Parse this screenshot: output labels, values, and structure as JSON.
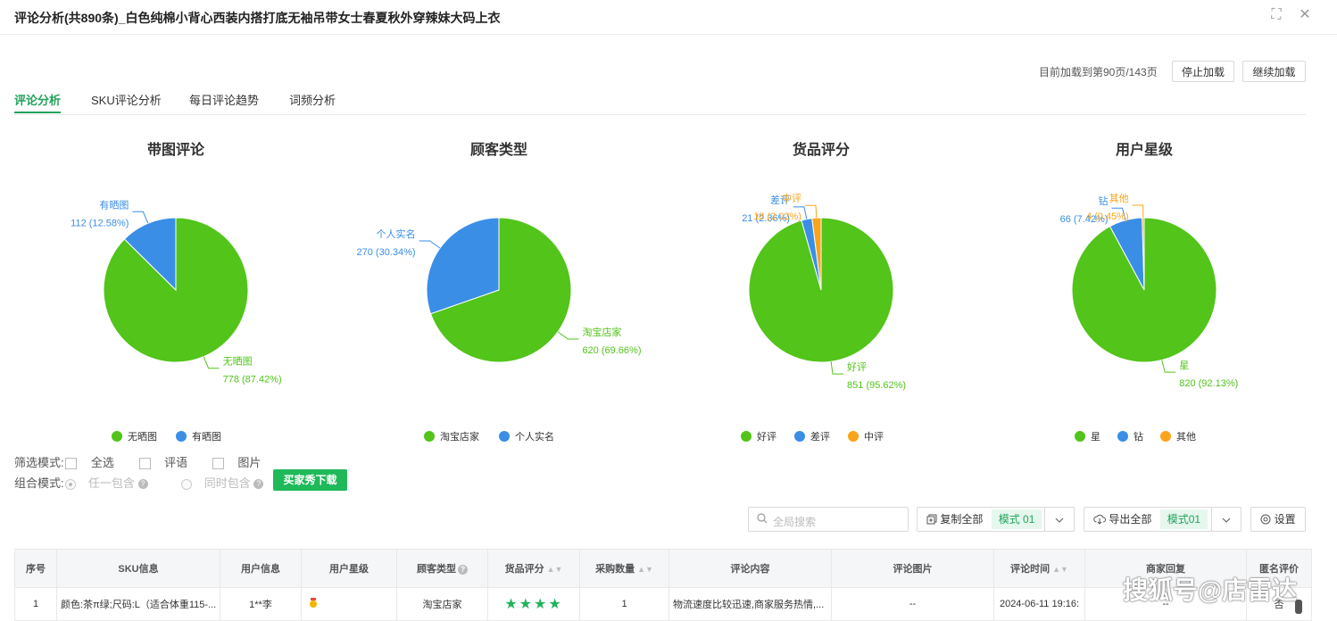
{
  "window": {
    "title": "评论分析(共890条)_白色纯棉小背心西装内搭打底无袖吊带女士春夏秋外穿辣妹大码上衣"
  },
  "toolbar": {
    "load_info": "目前加载到第90页/143页",
    "stop_label": "停止加载",
    "continue_label": "继续加载"
  },
  "tabs": [
    {
      "label": "评论分析",
      "active": true
    },
    {
      "label": "SKU评论分析",
      "active": false
    },
    {
      "label": "每日评论趋势",
      "active": false
    },
    {
      "label": "词频分析",
      "active": false
    }
  ],
  "charts": [
    {
      "title": "带图评论",
      "slices": [
        {
          "label": "无晒图",
          "value": 778,
          "pct": "87.42%",
          "color": "#52c41a"
        },
        {
          "label": "有晒图",
          "value": 112,
          "pct": "12.58%",
          "color": "#3a8ee6"
        }
      ]
    },
    {
      "title": "顾客类型",
      "slices": [
        {
          "label": "淘宝店家",
          "value": 620,
          "pct": "69.66%",
          "color": "#52c41a"
        },
        {
          "label": "个人实名",
          "value": 270,
          "pct": "30.34%",
          "color": "#3a8ee6"
        }
      ]
    },
    {
      "title": "货品评分",
      "slices": [
        {
          "label": "好评",
          "value": 851,
          "pct": "95.62%",
          "color": "#52c41a"
        },
        {
          "label": "差评",
          "value": 21,
          "pct": "2.36%",
          "color": "#3a8ee6"
        },
        {
          "label": "中评",
          "value": 18,
          "pct": "2.02%",
          "color": "#faa41a"
        }
      ]
    },
    {
      "title": "用户星级",
      "slices": [
        {
          "label": "星",
          "value": 820,
          "pct": "92.13%",
          "color": "#52c41a"
        },
        {
          "label": "钻",
          "value": 66,
          "pct": "7.42%",
          "color": "#3a8ee6"
        },
        {
          "label": "其他",
          "value": 4,
          "pct": "0.45%",
          "color": "#faa41a"
        }
      ]
    }
  ],
  "filters": {
    "mode_label": "筛选模式:",
    "options": [
      "全选",
      "评语",
      "图片"
    ],
    "combo_label": "组合模式:",
    "combo_options": [
      "任一包含",
      "同时包含"
    ],
    "download_label": "买家秀下载"
  },
  "actions": {
    "search_placeholder": "全局搜索",
    "copy_all": "复制全部",
    "copy_mode": "模式 01",
    "export_all": "导出全部",
    "export_mode": "模式01",
    "settings": "设置"
  },
  "table": {
    "headers": [
      "序号",
      "SKU信息",
      "用户信息",
      "用户星级",
      "顾客类型",
      "货品评分",
      "采购数量",
      "评论内容",
      "评论图片",
      "评论时间",
      "商家回复",
      "匿名评价"
    ],
    "rows": [
      {
        "index": "1",
        "sku": "颜色:茶π绿;尺码:L（适合体重115-...",
        "user": "1**李",
        "star": "",
        "customer_type": "淘宝店家",
        "rating_stars": 4,
        "qty": "1",
        "content": "物流速度比较迅速,商家服务热情,...",
        "images": "--",
        "time": "2024-06-11 19:16:",
        "reply": "--",
        "anonymous": "否"
      }
    ]
  },
  "watermark": "搜狐号@店雷达"
}
